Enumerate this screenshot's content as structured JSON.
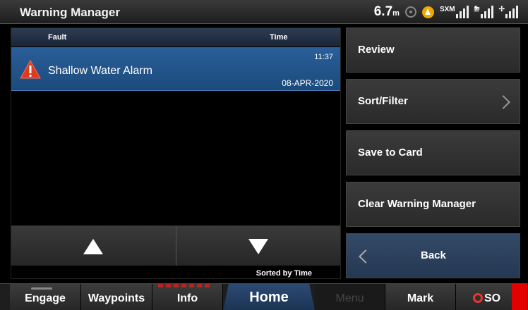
{
  "app": {
    "title": "Warning Manager"
  },
  "status": {
    "depth_value": "6.7",
    "depth_unit": "m",
    "sxm_label": "SXM",
    "icons": [
      "gps-icon",
      "warning-icon",
      "sxm-signal-icon",
      "weather-signal-icon",
      "ais-signal-icon"
    ]
  },
  "list": {
    "headers": {
      "fault": "Fault",
      "time": "Time"
    },
    "rows": [
      {
        "name": "Shallow Water Alarm",
        "time": "11:37",
        "date": "08-APR-2020",
        "icon": "warning-triangle-icon"
      }
    ],
    "sort_text": "Sorted by Time"
  },
  "menu": {
    "review": "Review",
    "sort_filter": "Sort/Filter",
    "save_to_card": "Save to Card",
    "clear": "Clear Warning Manager",
    "back": "Back"
  },
  "nav": {
    "engage": "Engage",
    "waypoints": "Waypoints",
    "info": "Info",
    "home": "Home",
    "menu": "Menu",
    "mark": "Mark",
    "sos": "SO"
  },
  "colors": {
    "accent": "#1c4a7c",
    "alarm": "#e03a1e",
    "sos": "#e20000"
  }
}
